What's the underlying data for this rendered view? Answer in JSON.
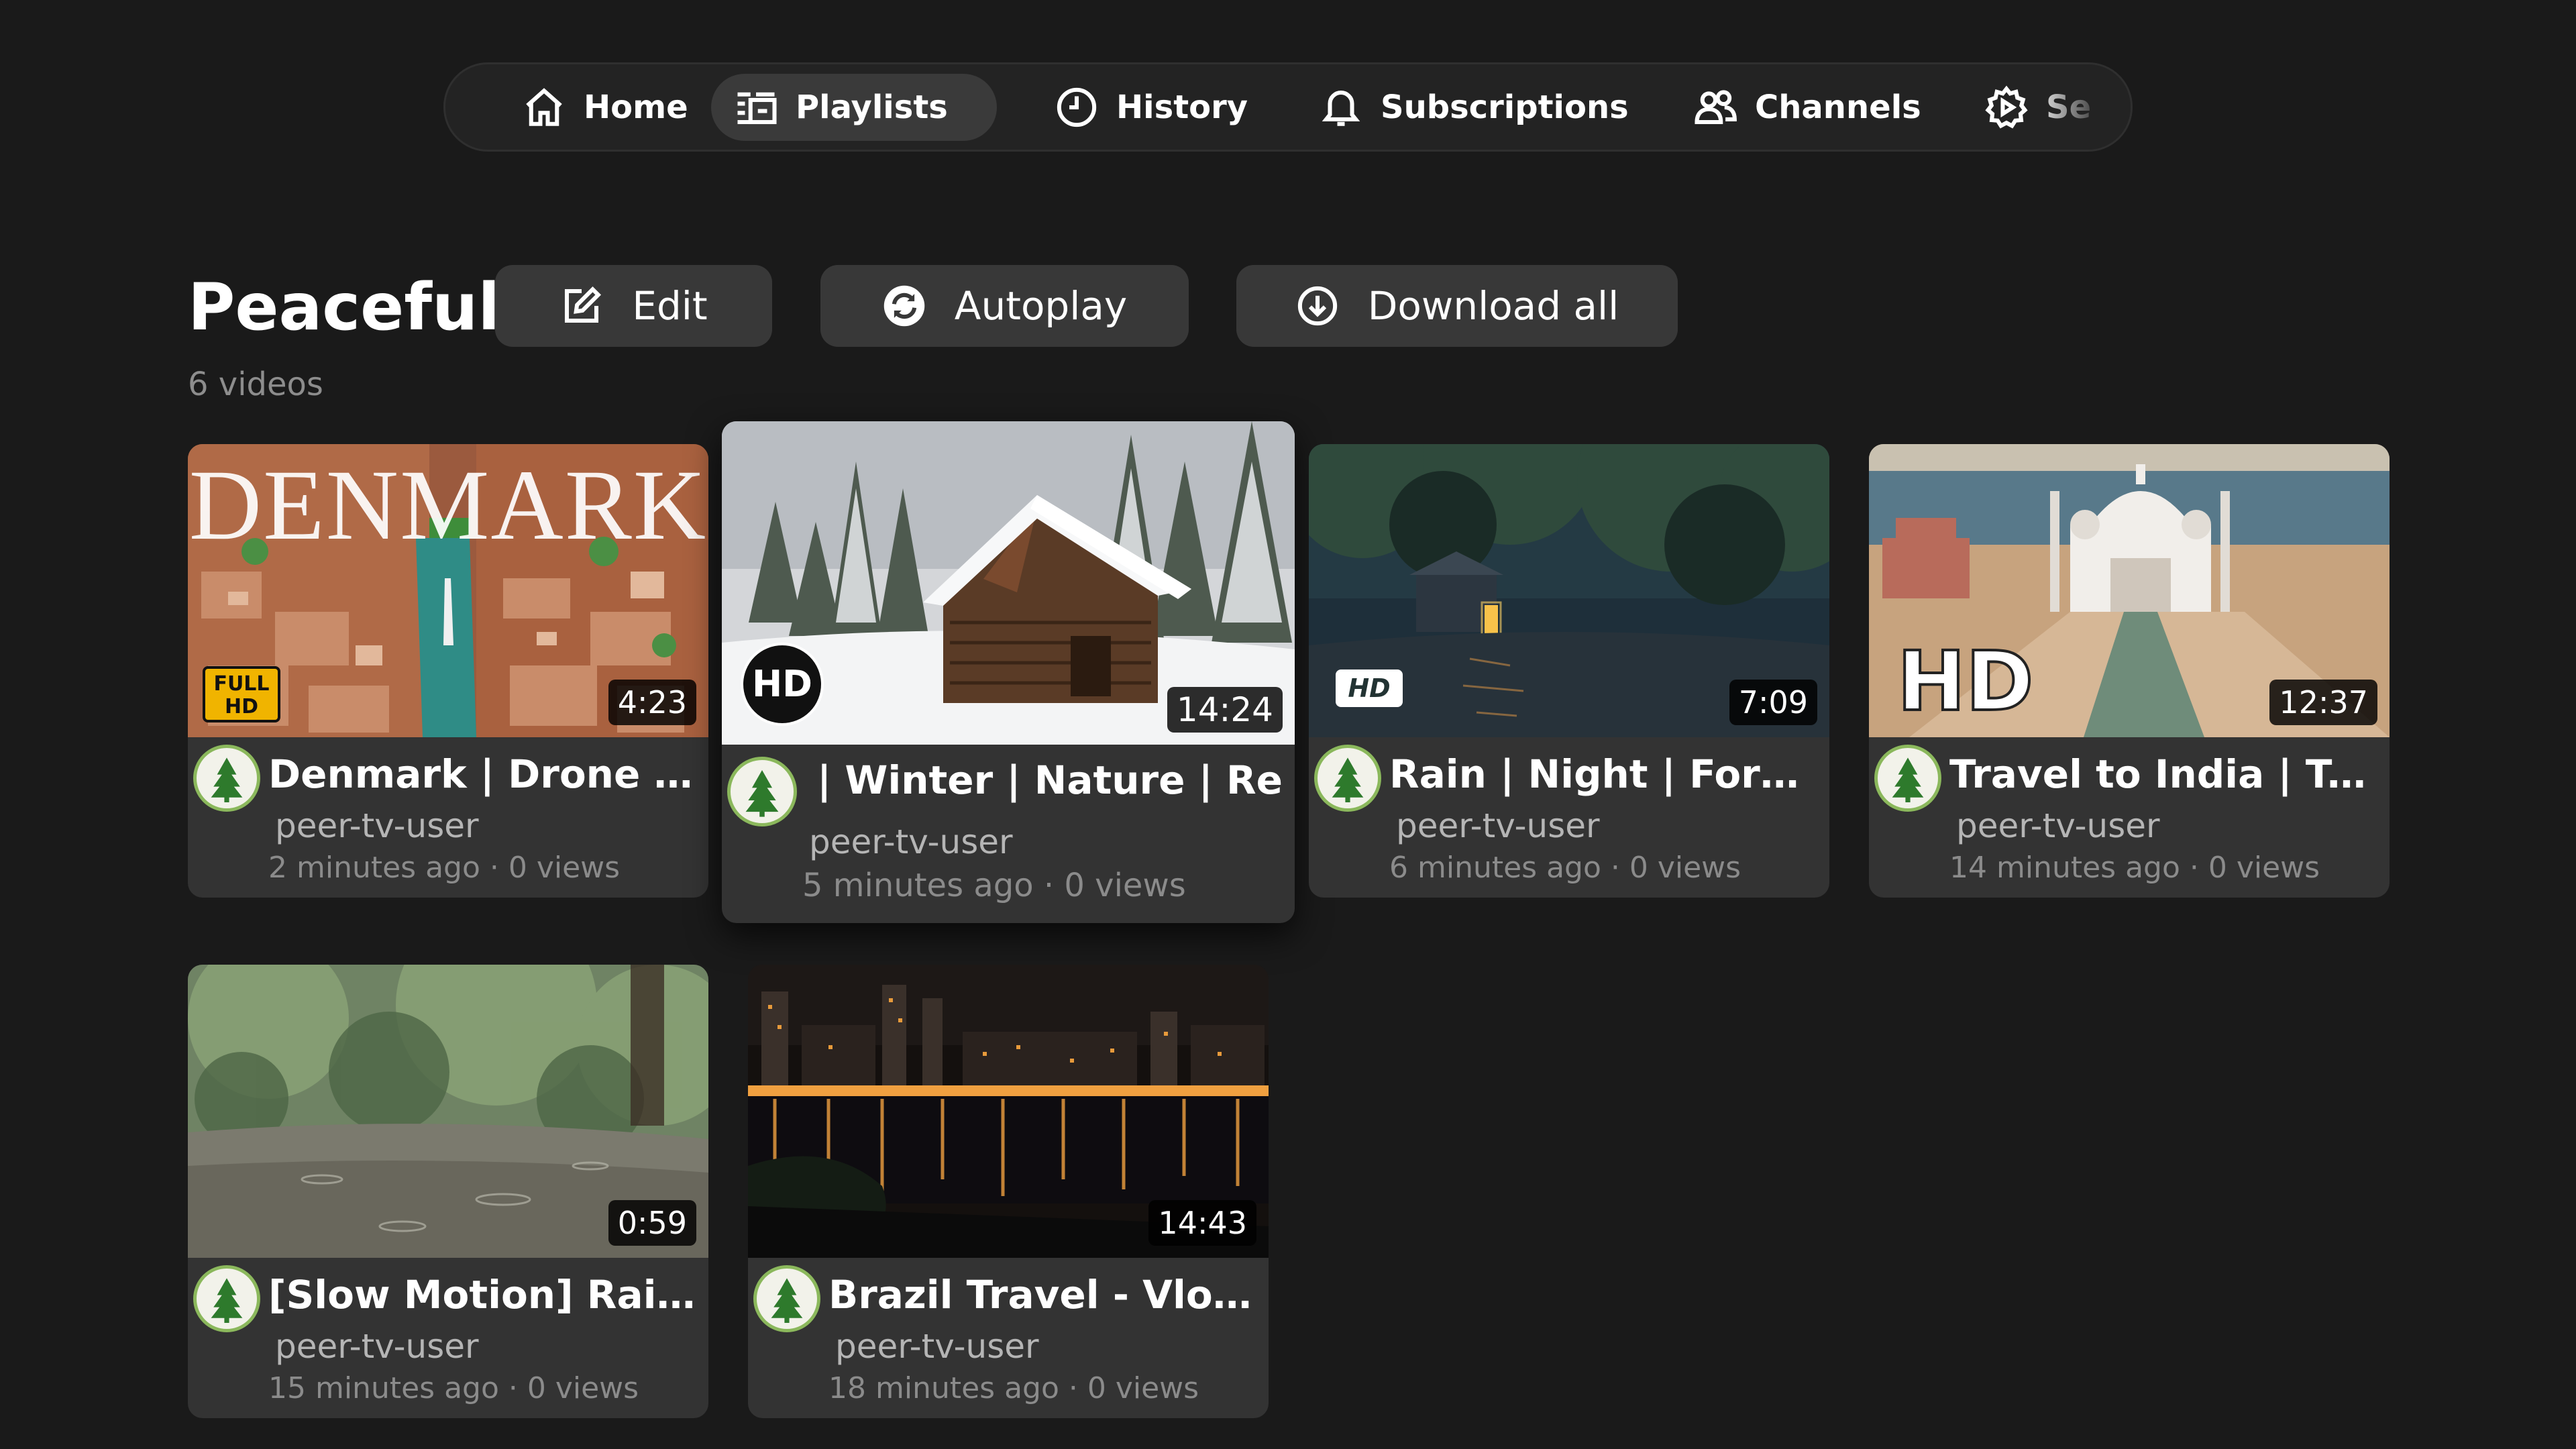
{
  "nav": {
    "items": [
      {
        "label": "Home",
        "icon": "home-icon"
      },
      {
        "label": "Playlists",
        "icon": "playlist-icon",
        "active": true
      },
      {
        "label": "History",
        "icon": "clock-icon"
      },
      {
        "label": "Subscriptions",
        "icon": "bell-icon"
      },
      {
        "label": "Channels",
        "icon": "users-icon"
      },
      {
        "label": "Se",
        "icon": "gear-icon"
      }
    ]
  },
  "playlist": {
    "title": "Peaceful",
    "count": "6 videos",
    "edit_label": "Edit",
    "autoplay_label": "Autoplay",
    "download_label": "Download all"
  },
  "videos": [
    {
      "title": "Denmark | Drone | Na...",
      "channel": "peer-tv-user",
      "meta": "2 minutes ago · 0 views",
      "duration": "4:23",
      "overlay_text": "DENMARK",
      "badge": "FULL HD"
    },
    {
      "title": "Snow | Winter | Nature | Re",
      "channel": "peer-tv-user",
      "meta": "5 minutes ago · 0 views",
      "duration": "14:24",
      "badge": "HD",
      "focused": true
    },
    {
      "title": "Rain | Night | Forest |...",
      "channel": "peer-tv-user",
      "meta": "6 minutes ago · 0 views",
      "duration": "7:09",
      "badge": "HD"
    },
    {
      "title": "Travel to India | Taj M...",
      "channel": "peer-tv-user",
      "meta": "14 minutes ago · 0 views",
      "duration": "12:37",
      "badge": "HD"
    },
    {
      "title": "[Slow Motion] Rain St...",
      "channel": "peer-tv-user",
      "meta": "15 minutes ago · 0 views",
      "duration": "0:59"
    },
    {
      "title": "Brazil Travel - Vlog | R...",
      "channel": "peer-tv-user",
      "meta": "18 minutes ago · 0 views",
      "duration": "14:43"
    }
  ],
  "colors": {
    "background": "#1a1a1a",
    "card": "#333333",
    "nav_active": "#3a3a3a",
    "avatar_ring": "#8bb85c"
  }
}
